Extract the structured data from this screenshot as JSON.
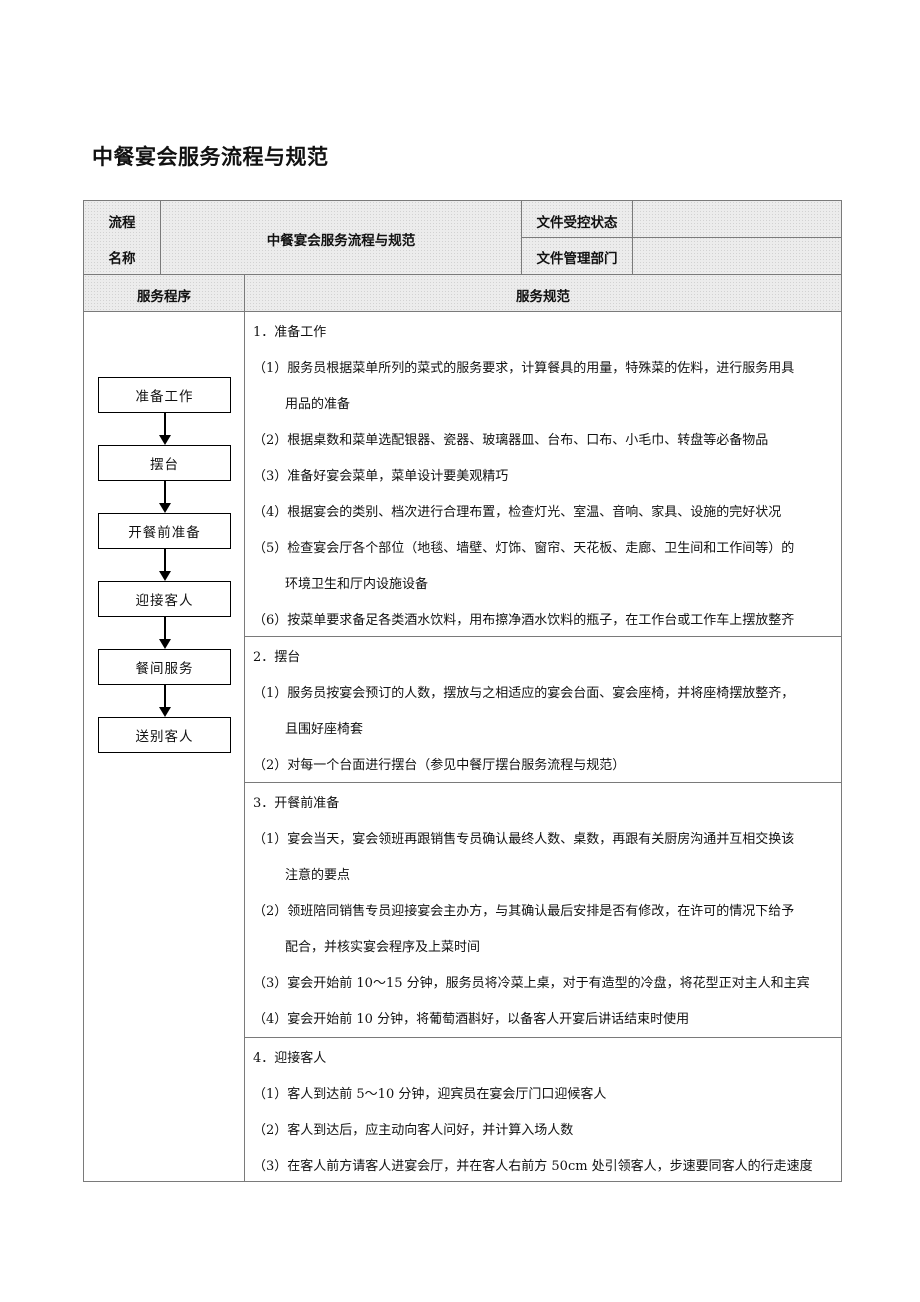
{
  "document": {
    "title": "中餐宴会服务流程与规范"
  },
  "header_table": {
    "flow_name_label_line1": "流程",
    "flow_name_label_line2": "名称",
    "flow_name_value": "中餐宴会服务流程与规范",
    "control_status_label": "文件受控状态",
    "control_status_value": "",
    "managing_dept_label": "文件管理部门",
    "managing_dept_value": "",
    "col_procedure": "服务程序",
    "col_standard": "服务规范"
  },
  "flowchart": {
    "steps": [
      "准备工作",
      "摆台",
      "开餐前准备",
      "迎接客人",
      "餐间服务",
      "送别客人"
    ]
  },
  "sections": [
    {
      "heading": "1．准备工作",
      "lines": [
        {
          "text": "（1）服务员根据菜单所列的菜式的服务要求，计算餐具的用量，特殊菜的佐料，进行服务用具",
          "indent": false
        },
        {
          "text": "用品的准备",
          "indent": true
        },
        {
          "text": "（2）根据桌数和菜单选配银器、瓷器、玻璃器皿、台布、口布、小毛巾、转盘等必备物品",
          "indent": false
        },
        {
          "text": "（3）准备好宴会菜单，菜单设计要美观精巧",
          "indent": false
        },
        {
          "text": "（4）根据宴会的类别、档次进行合理布置，检查灯光、室温、音响、家具、设施的完好状况",
          "indent": false
        },
        {
          "text": "（5）检查宴会厅各个部位（地毯、墙壁、灯饰、窗帘、天花板、走廊、卫生间和工作间等）的",
          "indent": false
        },
        {
          "text": "环境卫生和厅内设施设备",
          "indent": true
        },
        {
          "text": "（6）按菜单要求备足各类酒水饮料，用布擦净酒水饮料的瓶子，在工作台或工作车上摆放整齐",
          "indent": false
        }
      ]
    },
    {
      "heading": "2．摆台",
      "lines": [
        {
          "text": "（1）服务员按宴会预订的人数，摆放与之相适应的宴会台面、宴会座椅，并将座椅摆放整齐，",
          "indent": false
        },
        {
          "text": "且围好座椅套",
          "indent": true
        },
        {
          "text": "（2）对每一个台面进行摆台（参见中餐厅摆台服务流程与规范）",
          "indent": false
        }
      ]
    },
    {
      "heading": "3．开餐前准备",
      "lines": [
        {
          "text": "（1）宴会当天，宴会领班再跟销售专员确认最终人数、桌数，再跟有关厨房沟通并互相交换该",
          "indent": false
        },
        {
          "text": "注意的要点",
          "indent": true
        },
        {
          "text": "（2）领班陪同销售专员迎接宴会主办方，与其确认最后安排是否有修改，在许可的情况下给予",
          "indent": false
        },
        {
          "text": "配合，并核实宴会程序及上菜时间",
          "indent": true
        },
        {
          "text": "（3）宴会开始前 10～15 分钟，服务员将冷菜上桌，对于有造型的冷盘，将花型正对主人和主宾",
          "indent": false
        },
        {
          "text": "（4）宴会开始前 10 分钟，将葡萄酒斟好，以备客人开宴后讲话结束时使用",
          "indent": false
        }
      ]
    },
    {
      "heading": "4．迎接客人",
      "lines": [
        {
          "text": "（1）客人到达前 5～10 分钟，迎宾员在宴会厅门口迎候客人",
          "indent": false
        },
        {
          "text": "（2）客人到达后，应主动向客人问好，并计算入场人数",
          "indent": false
        },
        {
          "text": "（3）在客人前方请客人进宴会厅，并在客人右前方 50cm 处引领客人，步速要同客人的行走速度",
          "indent": false
        }
      ]
    }
  ]
}
